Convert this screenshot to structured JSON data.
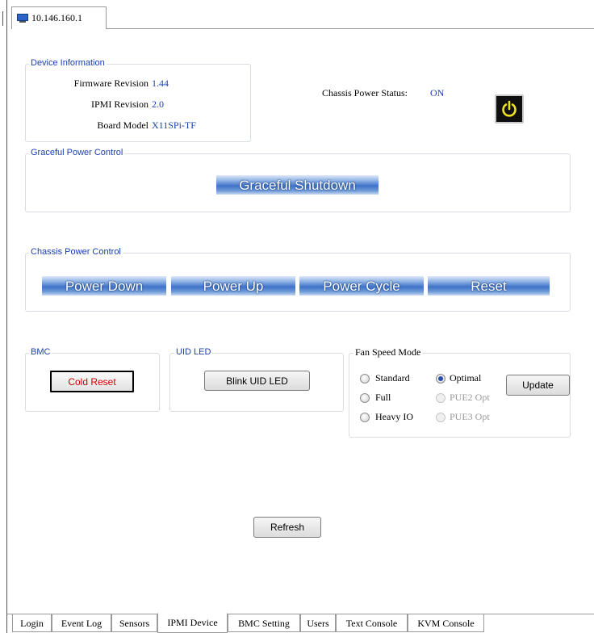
{
  "window": {
    "tab_title": "10.146.160.1"
  },
  "device_info": {
    "title": "Device Information",
    "firmware_label": "Firmware Revision",
    "firmware_value": "1.44",
    "ipmi_label": "IPMI Revision",
    "ipmi_value": "2.0",
    "board_label": "Board Model",
    "board_value": "X11SPi-TF"
  },
  "chassis_status": {
    "label": "Chassis Power Status:",
    "value": "ON"
  },
  "graceful": {
    "title": "Graceful Power Control",
    "shutdown_label": "Graceful Shutdown"
  },
  "chassis_control": {
    "title": "Chassis Power Control",
    "buttons": [
      "Power Down",
      "Power Up",
      "Power Cycle",
      "Reset"
    ]
  },
  "bmc": {
    "title": "BMC",
    "cold_reset_label": "Cold Reset"
  },
  "uid": {
    "title": "UID LED",
    "blink_label": "Blink UID LED"
  },
  "fan": {
    "title": "Fan Speed Mode",
    "options": [
      {
        "label": "Standard",
        "selected": false,
        "enabled": true
      },
      {
        "label": "Optimal",
        "selected": true,
        "enabled": true
      },
      {
        "label": "Full",
        "selected": false,
        "enabled": true
      },
      {
        "label": "PUE2 Opt",
        "selected": false,
        "enabled": false
      },
      {
        "label": "Heavy IO",
        "selected": false,
        "enabled": true
      },
      {
        "label": "PUE3 Opt",
        "selected": false,
        "enabled": false
      }
    ],
    "update_label": "Update"
  },
  "refresh_label": "Refresh",
  "bottom_tabs": [
    {
      "label": "Login",
      "active": false
    },
    {
      "label": "Event Log",
      "active": false
    },
    {
      "label": "Sensors",
      "active": false
    },
    {
      "label": "IPMI Device",
      "active": true
    },
    {
      "label": "BMC Setting",
      "active": false
    },
    {
      "label": "Users",
      "active": false
    },
    {
      "label": "Text Console",
      "active": false
    },
    {
      "label": "KVM Console",
      "active": false
    }
  ],
  "colors": {
    "link_blue": "#1a3fae",
    "danger_red": "#d00000",
    "button_blue": "#3f73c8"
  }
}
